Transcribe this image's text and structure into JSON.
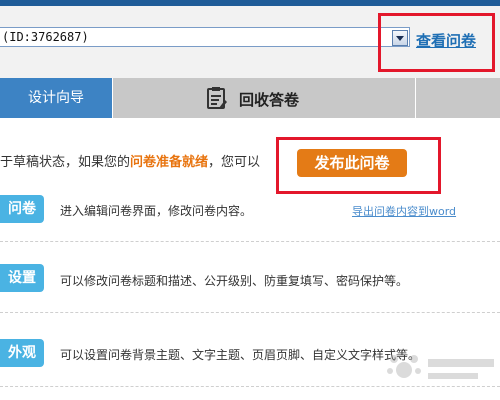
{
  "survey_select": {
    "value": "(ID:3762687)"
  },
  "header": {
    "view_survey_link": "查看问卷"
  },
  "tabs": [
    {
      "label": "设计向导",
      "active": true
    },
    {
      "label": "回收答卷",
      "icon": "clipboard-icon"
    },
    {
      "label": ""
    }
  ],
  "status": {
    "prefix": "于草稿状态，如果您的",
    "highlight": "问卷准备就绪",
    "suffix": "，您可以",
    "publish_button": "发布此问卷"
  },
  "rows": [
    {
      "button": "问卷",
      "description": "进入编辑问卷界面，修改问卷内容。",
      "link": "导出问卷内容到word"
    },
    {
      "button": "设置",
      "description": "可以修改问卷标题和描述、公开级别、防重复填写、密码保护等。"
    },
    {
      "button": "外观",
      "description": "可以设置问卷背景主题、文字主题、页眉页脚、自定义文字样式等。"
    }
  ],
  "colors": {
    "top_bar": "#1f5c98",
    "active_tab": "#3d83c4",
    "inactive_tab": "#c8c8c8",
    "publish_button": "#e47b16",
    "highlight_text": "#e8740f",
    "row_button": "#4ab3e3",
    "link": "#1f6fb4",
    "annotation_box": "#e3172b"
  }
}
